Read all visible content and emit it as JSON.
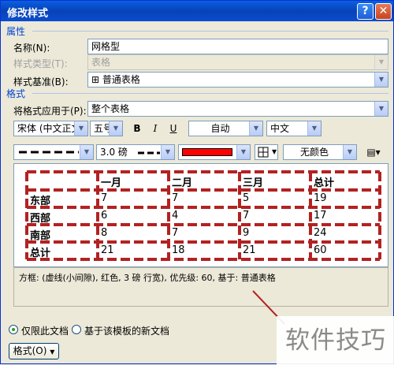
{
  "title": "修改样式",
  "sections": {
    "properties": "属性",
    "format": "格式"
  },
  "properties": {
    "name_label": "名称(N):",
    "name_value": "网格型",
    "type_label": "样式类型(T):",
    "type_value": "表格",
    "base_label": "样式基准(B):",
    "base_value": "普通表格"
  },
  "format": {
    "apply_label": "将格式应用于(P):",
    "apply_value": "整个表格",
    "font": "宋体 (中文正文",
    "size": "五号",
    "bold": "B",
    "italic": "I",
    "underline": "U",
    "color": "自动",
    "script": "中文",
    "border_weight": "3.0 磅",
    "border_color": "#ff0000",
    "fill": "无颜色"
  },
  "preview": {
    "headers": [
      "",
      "一月",
      "二月",
      "三月",
      "总计"
    ],
    "rows": [
      [
        "东部",
        "7",
        "7",
        "5",
        "19"
      ],
      [
        "西部",
        "6",
        "4",
        "7",
        "17"
      ],
      [
        "南部",
        "8",
        "7",
        "9",
        "24"
      ],
      [
        "总计",
        "21",
        "18",
        "21",
        "60"
      ]
    ]
  },
  "description": "方框: (虚线(小间隙), 红色, 3 磅 行宽), 优先级: 60, 基于: 普通表格",
  "options": {
    "only_doc": "仅限此文档",
    "new_doc": "基于该模板的新文档"
  },
  "buttons": {
    "format": "格式(O)"
  },
  "watermark": "软件技巧"
}
